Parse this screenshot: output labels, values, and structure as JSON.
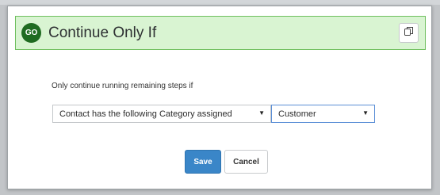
{
  "header": {
    "badge": "GO",
    "title": "Continue Only If",
    "copy_icon": "copy-icon"
  },
  "body": {
    "prompt": "Only continue running remaining steps if",
    "condition_select": "Contact has the following Category assigned",
    "value_select": "Customer",
    "caret": "▼"
  },
  "footer": {
    "save_label": "Save",
    "cancel_label": "Cancel"
  },
  "colors": {
    "header_bg": "#d9f4d2",
    "header_border": "#6fbf5e",
    "badge": "#1f6b21",
    "save": "#3a86c8"
  }
}
